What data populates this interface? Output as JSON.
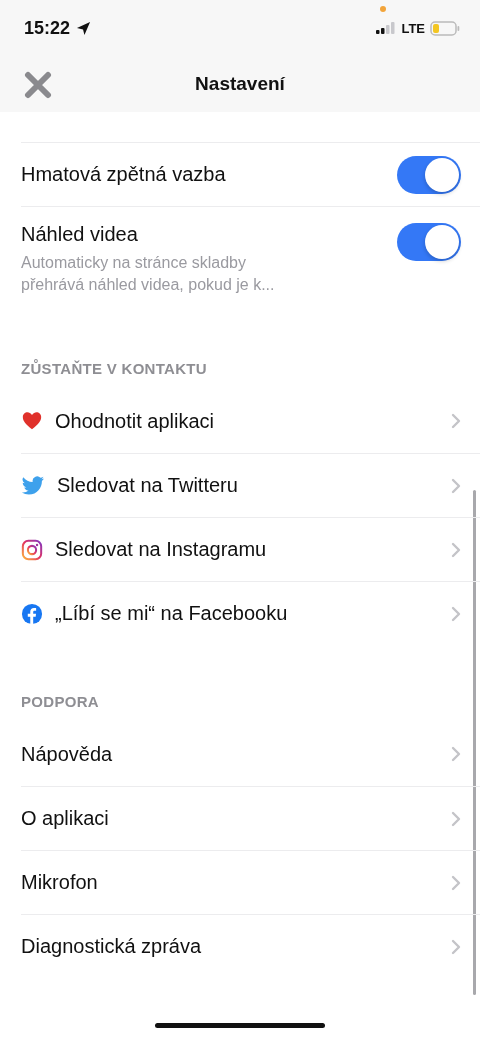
{
  "status_bar": {
    "time": "15:22",
    "network": "LTE"
  },
  "nav": {
    "title": "Nastavení"
  },
  "sections": [
    {
      "rows": [
        {
          "kind": "toggle",
          "label": "Hmatová zpětná vazba",
          "on": true
        },
        {
          "kind": "toggle",
          "label": "Náhled videa",
          "description": "Automaticky na stránce skladby přehrává náhled videa, pokud je k...",
          "on": true
        }
      ]
    },
    {
      "title": "ZŮSTAŇTE V KONTAKTU",
      "rows": [
        {
          "kind": "link",
          "label": "Ohodnotit aplikaci"
        },
        {
          "kind": "link",
          "label": "Sledovat na Twitteru"
        },
        {
          "kind": "link",
          "label": "Sledovat na Instagramu"
        },
        {
          "kind": "link",
          "label": "„Líbí se mi“ na Facebooku"
        }
      ]
    },
    {
      "title": "PODPORA",
      "rows": [
        {
          "kind": "link",
          "label": "Nápověda"
        },
        {
          "kind": "link",
          "label": "O aplikaci"
        },
        {
          "kind": "link",
          "label": "Mikrofon"
        },
        {
          "kind": "link",
          "label": "Diagnostická zpráva"
        }
      ]
    }
  ]
}
